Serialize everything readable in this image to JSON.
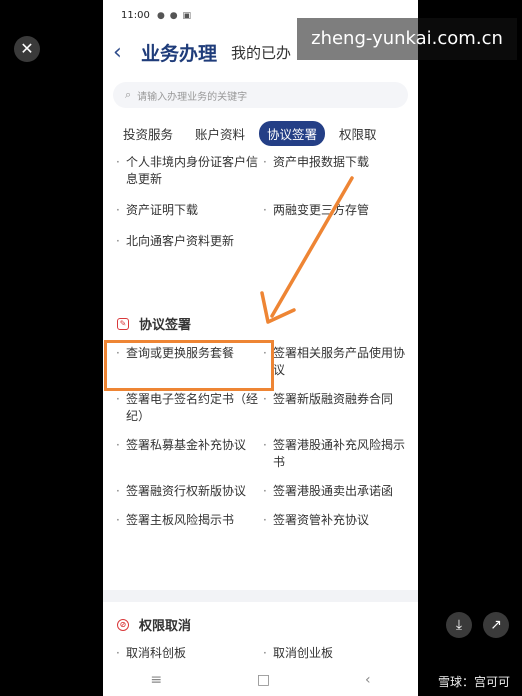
{
  "status": {
    "time": "11:00"
  },
  "header": {
    "back_icon": "back-arrow-icon",
    "title": "业务办理",
    "extra": "我的已办"
  },
  "search": {
    "placeholder": "请输入办理业务的关键字"
  },
  "tabs": [
    "投资服务",
    "账户资料",
    "协议签署",
    "权限取"
  ],
  "active_tab": "协议签署",
  "account_items": [
    "个人非境内身份证客户信息更新",
    "资产申报数据下载",
    "资产证明下载",
    "两融变更三方存管",
    "北向通客户资料更新"
  ],
  "sections": {
    "agreement": {
      "title": "协议签署",
      "items": [
        "查询或更换服务套餐",
        "签署相关服务产品使用协议",
        "签署电子签名约定书（经纪）",
        "签署新版融资融券合同",
        "签署私募基金补充协议",
        "签署港股通补充风险揭示书",
        "签署融资行权新版协议",
        "签署港股通卖出承诺函",
        "签署主板风险揭示书",
        "签署资管补充协议"
      ]
    },
    "cancel": {
      "title": "权限取消",
      "items": [
        "取消科创板",
        "取消创业板"
      ]
    }
  },
  "watermark": {
    "url": "zheng-yunkai.com.cn",
    "footer": "雪球：宫可可"
  },
  "colors": {
    "brand": "#243f86",
    "highlight": "#ee8534",
    "section_icon": "#d9383a"
  }
}
